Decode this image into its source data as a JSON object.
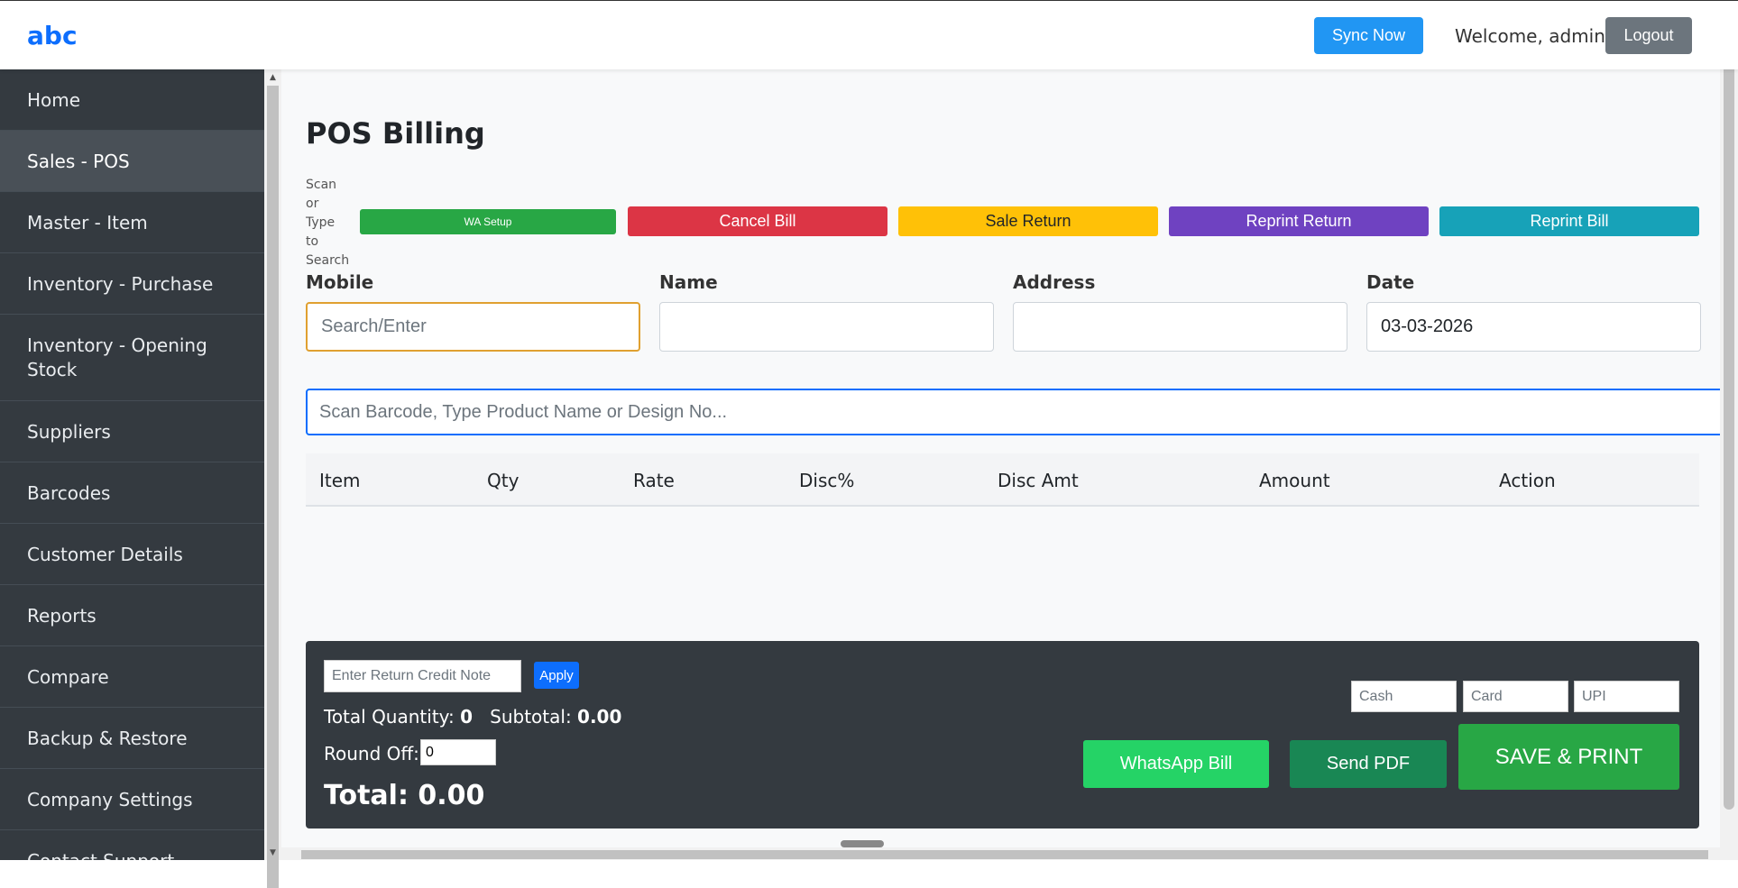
{
  "header": {
    "brand": "abc",
    "sync_label": "Sync Now",
    "welcome": "Welcome, admin",
    "logout_label": "Logout"
  },
  "sidebar": {
    "items": [
      {
        "label": "Home",
        "active": false
      },
      {
        "label": "Sales - POS",
        "active": true
      },
      {
        "label": "Master - Item",
        "active": false
      },
      {
        "label": "Inventory - Purchase",
        "active": false
      },
      {
        "label": "Inventory - Opening Stock",
        "active": false
      },
      {
        "label": "Suppliers",
        "active": false
      },
      {
        "label": "Barcodes",
        "active": false
      },
      {
        "label": "Customer Details",
        "active": false
      },
      {
        "label": "Reports",
        "active": false
      },
      {
        "label": "Compare",
        "active": false
      },
      {
        "label": "Backup & Restore",
        "active": false
      },
      {
        "label": "Company Settings",
        "active": false
      },
      {
        "label": "Contact Support",
        "active": false
      }
    ]
  },
  "main": {
    "title": "POS Billing",
    "scan_hint": "Scan or Type to Search",
    "actions": {
      "wa_setup": "WA Setup",
      "cancel_bill": "Cancel Bill",
      "sale_return": "Sale Return",
      "reprint_return": "Reprint Return",
      "reprint_bill": "Reprint Bill"
    },
    "fields": {
      "mobile_label": "Mobile",
      "mobile_placeholder": "Search/Enter",
      "name_label": "Name",
      "address_label": "Address",
      "date_label": "Date",
      "date_value": "03-03-2026"
    },
    "barcode_placeholder": "Scan Barcode, Type Product Name or Design No...",
    "table": {
      "headers": [
        "Item",
        "Qty",
        "Rate",
        "Disc%",
        "Disc Amt",
        "Amount",
        "Action"
      ]
    }
  },
  "footer": {
    "credit_placeholder": "Enter Return Credit Note",
    "apply_label": "Apply",
    "total_quantity_label": "Total Quantity:",
    "total_quantity": "0",
    "subtotal_label": "Subtotal:",
    "subtotal": "0.00",
    "round_off_label": "Round Off:",
    "round_off_value": "0",
    "total_label": "Total: 0.00",
    "cash_placeholder": "Cash",
    "card_placeholder": "Card",
    "upi_placeholder": "UPI",
    "whatsapp_bill": "WhatsApp Bill",
    "send_pdf": "Send PDF",
    "save_print": "SAVE & PRINT"
  },
  "colors": {
    "brand": "#0d6efd",
    "sidebar_bg": "#343a40",
    "wa_setup": "#28a745",
    "cancel": "#dc3545",
    "sale_return": "#ffc107",
    "reprint_return": "#6f42c1",
    "reprint_bill": "#17a2b8"
  }
}
